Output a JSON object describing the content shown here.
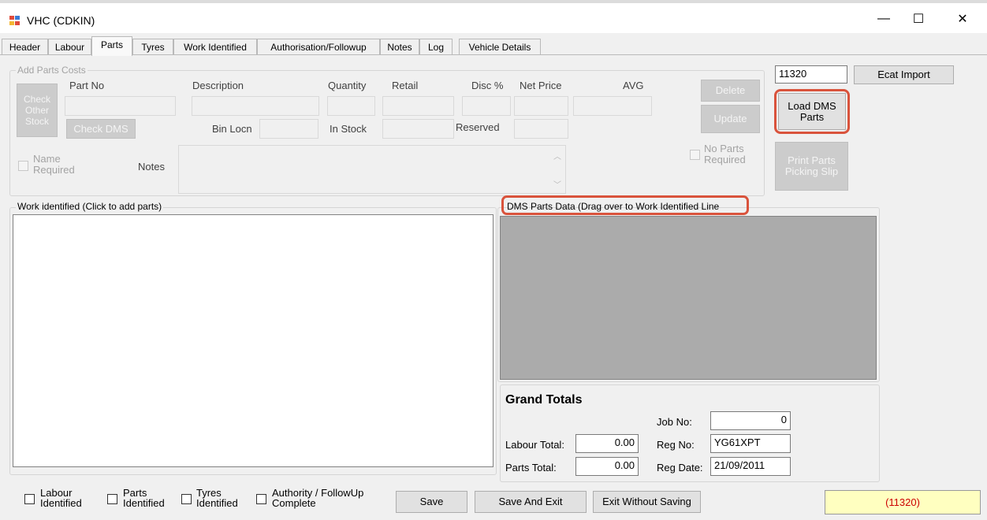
{
  "window": {
    "title": "VHC (CDKIN)",
    "minimize_glyph": "—",
    "maximize_glyph": "☐",
    "close_glyph": "✕"
  },
  "tabs": [
    "Header",
    "Labour",
    "Parts",
    "Tyres",
    "Work Identified",
    "Authorisation/Followup",
    "Notes",
    "Log",
    "Vehicle Details"
  ],
  "active_tab": "Parts",
  "add_parts": {
    "group_title": "Add Parts Costs",
    "part_no_label": "Part No",
    "description_label": "Description",
    "quantity_label": "Quantity",
    "retail_label": "Retail",
    "disc_label": "Disc %",
    "net_price_label": "Net Price",
    "avg_label": "AVG",
    "check_other_stock": "Check Other Stock",
    "check_dms": "Check DMS",
    "bin_locn_label": "Bin Locn",
    "in_stock_label": "In Stock",
    "reserved_label": "Reserved",
    "delete_button": "Delete",
    "update_button": "Update",
    "name_required": "Name Required",
    "notes_label": "Notes",
    "no_parts_required": "No Parts Required"
  },
  "right_panel": {
    "job_field_value": "11320",
    "ecat_import": "Ecat Import",
    "load_dms_parts": "Load DMS Parts",
    "print_parts_picking_slip": "Print Parts Picking Slip"
  },
  "work_identified": {
    "title": "Work identified (Click to add parts)"
  },
  "dms_parts": {
    "title": "DMS Parts Data (Drag over to Work Identified Line"
  },
  "grand_totals": {
    "title": "Grand Totals",
    "job_no_label": "Job No:",
    "job_no": "0",
    "labour_total_label": "Labour Total:",
    "labour_total": "0.00",
    "reg_no_label": "Reg No:",
    "reg_no": "YG61XPT",
    "parts_total_label": "Parts Total:",
    "parts_total": "0.00",
    "reg_date_label": "Reg Date:",
    "reg_date": "21/09/2011"
  },
  "footer": {
    "labour_identified": "Labour Identified",
    "parts_identified": "Parts Identified",
    "tyres_identified": "Tyres Identified",
    "authority_followup_complete": "Authority / FollowUp Complete",
    "save": "Save",
    "save_and_exit": "Save And Exit",
    "exit_without_saving": "Exit Without Saving",
    "status": "(11320)"
  },
  "colors": {
    "highlight_ring": "#d9533c",
    "status_bg": "#ffffc0",
    "status_text": "#cc0000",
    "dms_area": "#ababab"
  },
  "icons": [
    "app-icon",
    "minimize-icon",
    "maximize-icon",
    "close-icon",
    "scroll-up-icon",
    "scroll-down-icon"
  ]
}
